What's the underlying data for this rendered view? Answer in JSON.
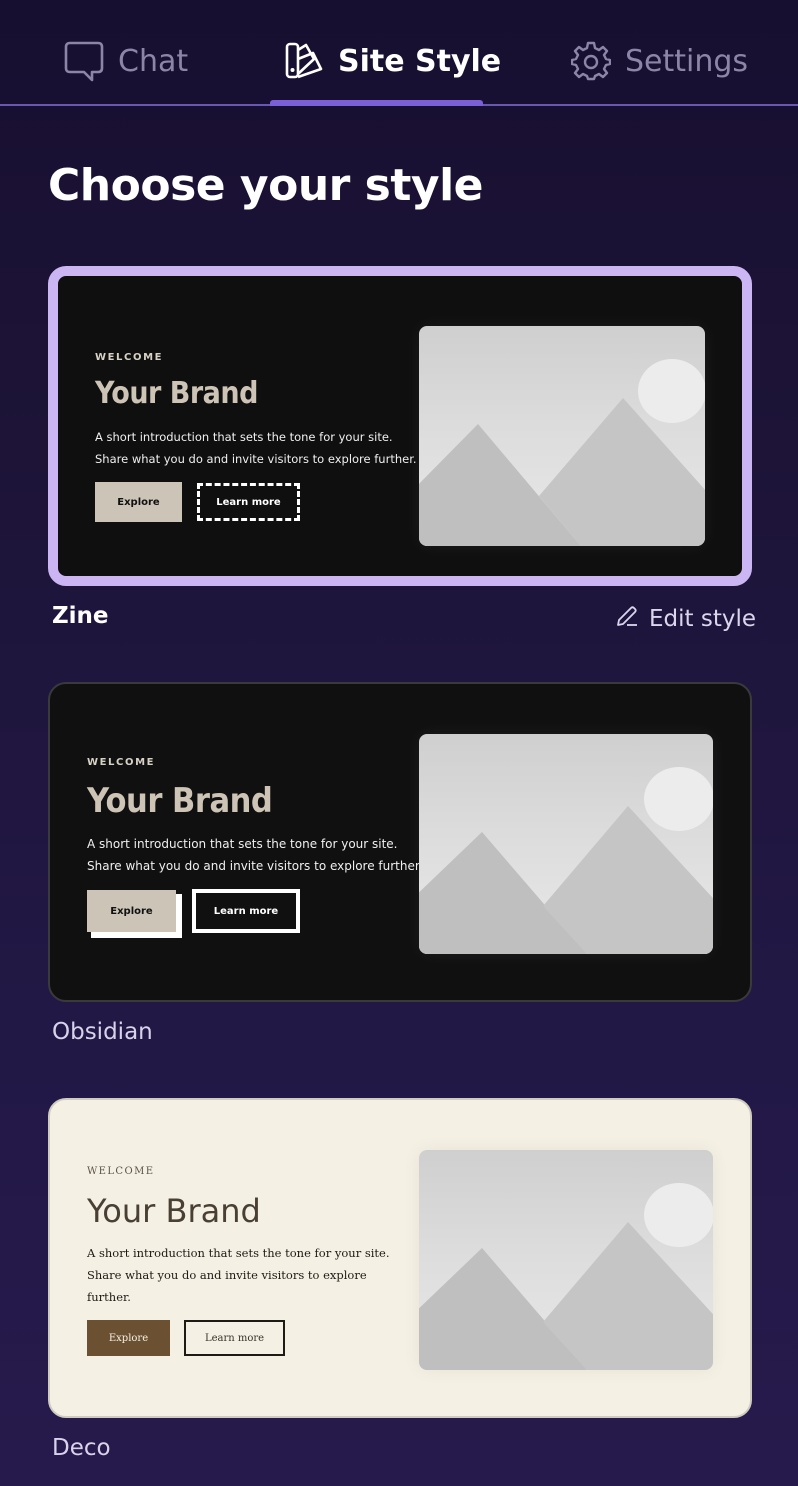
{
  "tabs": {
    "chat": "Chat",
    "site_style": "Site Style",
    "settings": "Settings"
  },
  "page_title": "Choose your style",
  "edit_style": "Edit style",
  "styles": [
    {
      "name": "Zine",
      "selected": true,
      "eyebrow": "WELCOME",
      "brand": "Your Brand",
      "intro_line1": "A short introduction that sets the tone for your site.",
      "intro_line2": "Share what you do and invite visitors to explore further.",
      "primary_button": "Explore",
      "secondary_button": "Learn more",
      "colors": {
        "background": "#0f0f10",
        "brand": "#cdc4b6",
        "primary_button": "#ccc4b7",
        "border": "#cbb6f3"
      }
    },
    {
      "name": "Obsidian",
      "selected": false,
      "eyebrow": "WELCOME",
      "brand": "Your Brand",
      "intro_line1": "A short introduction that sets the tone for your site.",
      "intro_line2": "Share what you do and invite visitors to explore further.",
      "primary_button": "Explore",
      "secondary_button": "Learn more",
      "colors": {
        "background": "#101011",
        "brand": "#cdc4b6",
        "primary_button": "#ccc4b7"
      }
    },
    {
      "name": "Deco",
      "selected": false,
      "eyebrow": "WELCOME",
      "brand": "Your Brand",
      "intro_line1": "A short introduction that sets the tone for your site.",
      "intro_line2": "Share what you do and invite visitors to explore",
      "intro_line3": "further.",
      "primary_button": "Explore",
      "secondary_button": "Learn more",
      "colors": {
        "background": "#f4f0e4",
        "brand": "#4a3f33",
        "primary_button": "#6b5131"
      }
    }
  ]
}
